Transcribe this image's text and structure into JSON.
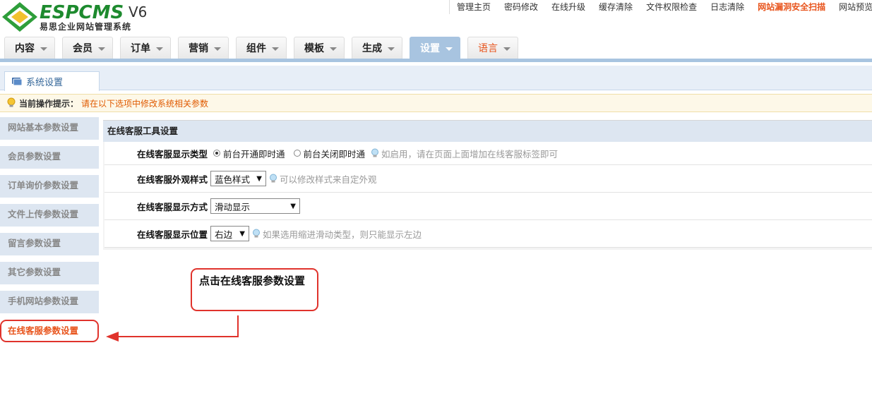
{
  "header": {
    "logo_word": "ESPCMS",
    "logo_version": "V6",
    "logo_subtitle": "易思企业网站管理系统",
    "top_links": [
      "管理主页",
      "密码修改",
      "在线升级",
      "缓存清除",
      "文件权限检查",
      "日志清除",
      "网站漏洞安全扫描",
      "网站预览"
    ]
  },
  "nav": {
    "tabs": [
      "内容",
      "会员",
      "订单",
      "营销",
      "组件",
      "模板",
      "生成",
      "设置",
      "语言"
    ],
    "active": "设置"
  },
  "subtab": {
    "label": "系统设置"
  },
  "tip": {
    "label": "当前操作提示：",
    "text": "请在以下选项中修改系统相关参数"
  },
  "sidebar": {
    "items": [
      "网站基本参数设置",
      "会员参数设置",
      "订单询价参数设置",
      "文件上传参数设置",
      "留言参数设置",
      "其它参数设置",
      "手机网站参数设置",
      "在线客服参数设置"
    ],
    "selected": "在线客服参数设置"
  },
  "panel": {
    "title": "在线客服工具设置",
    "rows": {
      "display_type": {
        "label": "在线客服显示类型",
        "option_on": "前台开通即时通",
        "option_off": "前台关闭即时通",
        "hint": "如启用，请在页面上面增加在线客服标签即可"
      },
      "style": {
        "label": "在线客服外观样式",
        "value": "蓝色样式",
        "hint": "可以修改样式来自定外观"
      },
      "mode": {
        "label": "在线客服显示方式",
        "value": "滑动显示"
      },
      "position": {
        "label": "在线客服显示位置",
        "value": "右边",
        "hint": "如果选用缩进滑动类型，则只能显示左边"
      }
    }
  },
  "callout": {
    "text": "点击在线客服参数设置"
  },
  "colors": {
    "accent": "#a8c4e0",
    "highlight": "#e0332c",
    "warning": "#e8541c"
  }
}
